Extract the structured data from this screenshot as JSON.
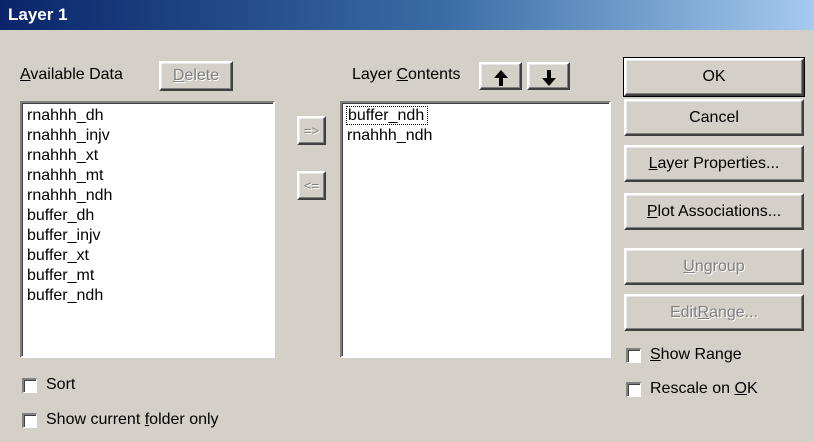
{
  "window": {
    "title": "Layer 1"
  },
  "available": {
    "label_pre": "",
    "label_ul": "A",
    "label_post": "vailable Data",
    "delete_ul": "D",
    "delete_post": "elete",
    "items": [
      "rnahhh_dh",
      "rnahhh_injv",
      "rnahhh_xt",
      "rnahhh_mt",
      "rnahhh_ndh",
      "buffer_dh",
      "buffer_injv",
      "buffer_xt",
      "buffer_mt",
      "buffer_ndh"
    ]
  },
  "transfer": {
    "add_label": "=>",
    "remove_label": "<="
  },
  "contents": {
    "label_pre": "Layer ",
    "label_ul": "C",
    "label_post": "ontents",
    "items": [
      "buffer_ndh",
      "rnahhh_ndh"
    ]
  },
  "buttons": {
    "ok": {
      "pre": "",
      "ul": "",
      "post": "OK"
    },
    "cancel": {
      "pre": "",
      "ul": "",
      "post": "Cancel"
    },
    "layer_properties": {
      "pre": "",
      "ul": "L",
      "post": "ayer Properties..."
    },
    "plot_associations": {
      "pre": "",
      "ul": "P",
      "post": "lot Associations..."
    },
    "ungroup": {
      "pre": "",
      "ul": "U",
      "post": "ngroup"
    },
    "edit_range": {
      "pre": "Edit ",
      "ul": "R",
      "post": "ange..."
    }
  },
  "checks": {
    "show_range": {
      "pre": "",
      "ul": "S",
      "post": "how Range"
    },
    "rescale_ok": {
      "pre": "Rescale on ",
      "ul": "O",
      "post": "K"
    },
    "sort": {
      "pre": "Sort",
      "ul": "",
      "post": ""
    },
    "show_current_folder": {
      "pre": "Show current ",
      "ul": "f",
      "post": "older only"
    }
  }
}
